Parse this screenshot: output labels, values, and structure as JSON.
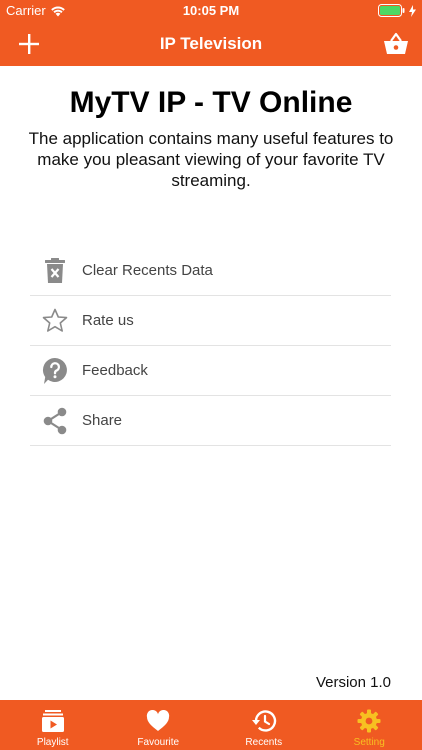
{
  "status_bar": {
    "carrier": "Carrier",
    "time": "10:05 PM"
  },
  "nav": {
    "title": "IP Television",
    "left_icon": "plus-icon",
    "right_icon": "basket-icon"
  },
  "app": {
    "title": "MyTV IP - TV Online",
    "description": "The application contains many useful features to make you pleasant viewing of your favorite TV streaming."
  },
  "menu": {
    "items": [
      {
        "label": "Clear Recents Data",
        "icon": "trash-icon"
      },
      {
        "label": "Rate us",
        "icon": "star-icon"
      },
      {
        "label": "Feedback",
        "icon": "help-icon"
      },
      {
        "label": "Share",
        "icon": "share-icon"
      }
    ]
  },
  "version": "Version 1.0",
  "tabs": [
    {
      "label": "Playlist",
      "icon": "playlist-icon",
      "active": false
    },
    {
      "label": "Favourite",
      "icon": "heart-icon",
      "active": false
    },
    {
      "label": "Recents",
      "icon": "history-icon",
      "active": false
    },
    {
      "label": "Setting",
      "icon": "gear-icon",
      "active": true
    }
  ],
  "colors": {
    "brand": "#f05a22",
    "active_tab": "#f7c021",
    "icon_gray": "#8a8a8a"
  }
}
